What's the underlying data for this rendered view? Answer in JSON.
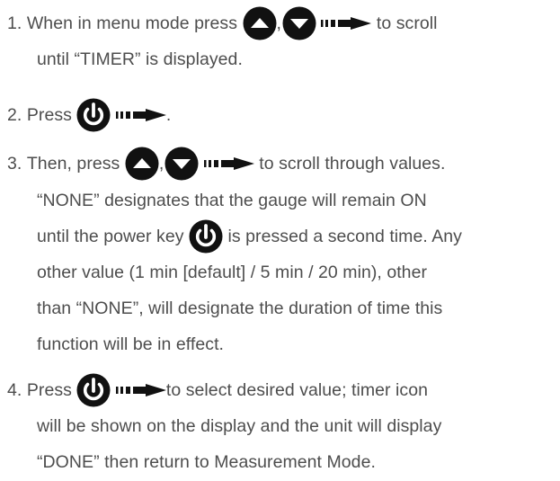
{
  "steps": [
    {
      "number": "1.",
      "l1a": "When in menu mode press",
      "l1b": ",",
      "l1c": "to scroll",
      "l2": "until “TIMER” is displayed."
    },
    {
      "number": "2.",
      "l1a": "Press",
      "l1b": "."
    },
    {
      "number": "3.",
      "l1a": "Then, press",
      "l1b": ",",
      "l1c": "to scroll through values.",
      "l2": "“NONE” designates that the gauge will remain ON",
      "l3a": "until the power key",
      "l3b": "is pressed a second time. Any",
      "l4": "other value (1 min [default] / 5 min / 20 min), other",
      "l5": "than “NONE”, will designate the duration of time this",
      "l6": "function will be in effect."
    },
    {
      "number": "4.",
      "l1a": "Press",
      "l1b": "to select desired value; timer icon",
      "l2": "will be shown on the display and the unit will display",
      "l3": "“DONE” then return to Measurement Mode."
    }
  ],
  "icons": {
    "up": "up-key-icon",
    "down": "down-key-icon",
    "power": "power-key-icon",
    "arrow": "then-arrow-icon"
  },
  "colors": {
    "text": "#4d4d4d",
    "icon": "#111111"
  }
}
